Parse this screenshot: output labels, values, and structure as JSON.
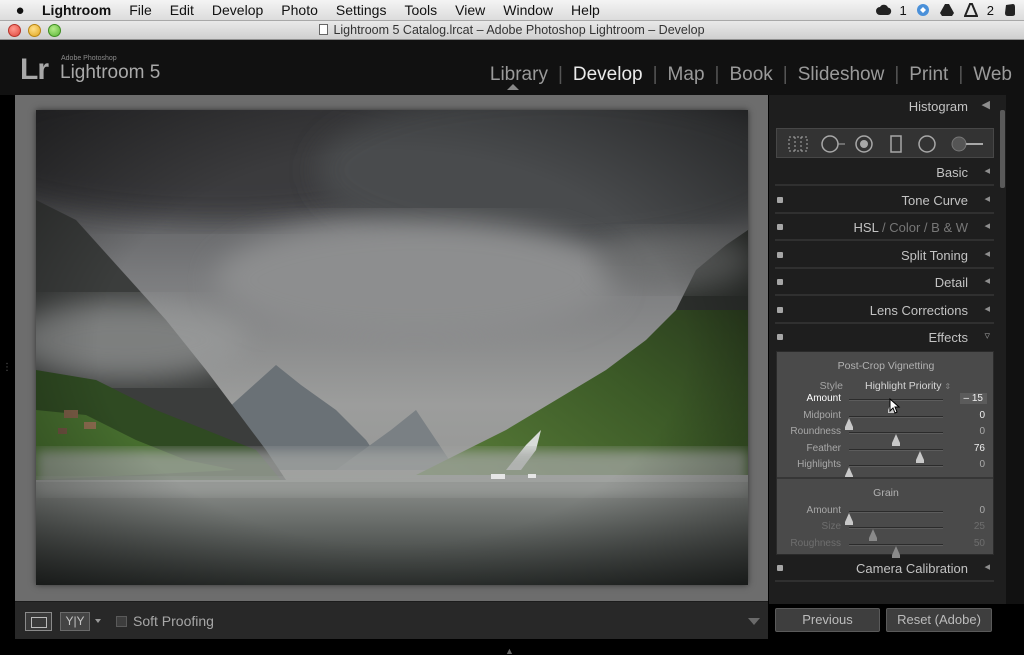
{
  "menubar": {
    "apple": "",
    "items": [
      "Lightroom",
      "File",
      "Edit",
      "Develop",
      "Photo",
      "Settings",
      "Tools",
      "View",
      "Window",
      "Help"
    ],
    "tray": {
      "cc_count": "1",
      "adobe_count": "2"
    }
  },
  "window": {
    "title": "Lightroom 5 Catalog.lrcat – Adobe Photoshop Lightroom – Develop"
  },
  "brand": {
    "logo": "Lr",
    "small": "Adobe Photoshop",
    "name": "Lightroom 5"
  },
  "modules": [
    {
      "label": "Library",
      "active": false
    },
    {
      "label": "Develop",
      "active": true
    },
    {
      "label": "Map",
      "active": false
    },
    {
      "label": "Book",
      "active": false
    },
    {
      "label": "Slideshow",
      "active": false
    },
    {
      "label": "Print",
      "active": false
    },
    {
      "label": "Web",
      "active": false
    }
  ],
  "toolbar": {
    "yy": "Y|Y",
    "soft_proofing": "Soft Proofing"
  },
  "panels": {
    "histogram": "Histogram",
    "basic": "Basic",
    "tone_curve": "Tone Curve",
    "hsl": "HSL",
    "hsl_sep1": "/",
    "color": "Color",
    "hsl_sep2": "/",
    "bw": "B & W",
    "split_toning": "Split Toning",
    "detail": "Detail",
    "lens_corrections": "Lens Corrections",
    "effects": "Effects",
    "camera_calibration": "Camera Calibration"
  },
  "effects": {
    "vignette_title": "Post-Crop Vignetting",
    "style_label": "Style",
    "style_value": "Highlight Priority",
    "vignette_sliders": [
      {
        "label": "Amount",
        "value": "– 15",
        "pos": 0.46
      },
      {
        "label": "Midpoint",
        "value": "0",
        "pos": 0.0
      },
      {
        "label": "Roundness",
        "value": "0",
        "pos": 0.5
      },
      {
        "label": "Feather",
        "value": "76",
        "pos": 0.76
      },
      {
        "label": "Highlights",
        "value": "0",
        "pos": 0.0
      }
    ],
    "grain_title": "Grain",
    "grain_sliders": [
      {
        "label": "Amount",
        "value": "0",
        "pos": 0.0
      },
      {
        "label": "Size",
        "value": "25",
        "pos": 0.25
      },
      {
        "label": "Roughness",
        "value": "50",
        "pos": 0.5
      }
    ]
  },
  "buttons": {
    "previous": "Previous",
    "reset": "Reset (Adobe)"
  }
}
